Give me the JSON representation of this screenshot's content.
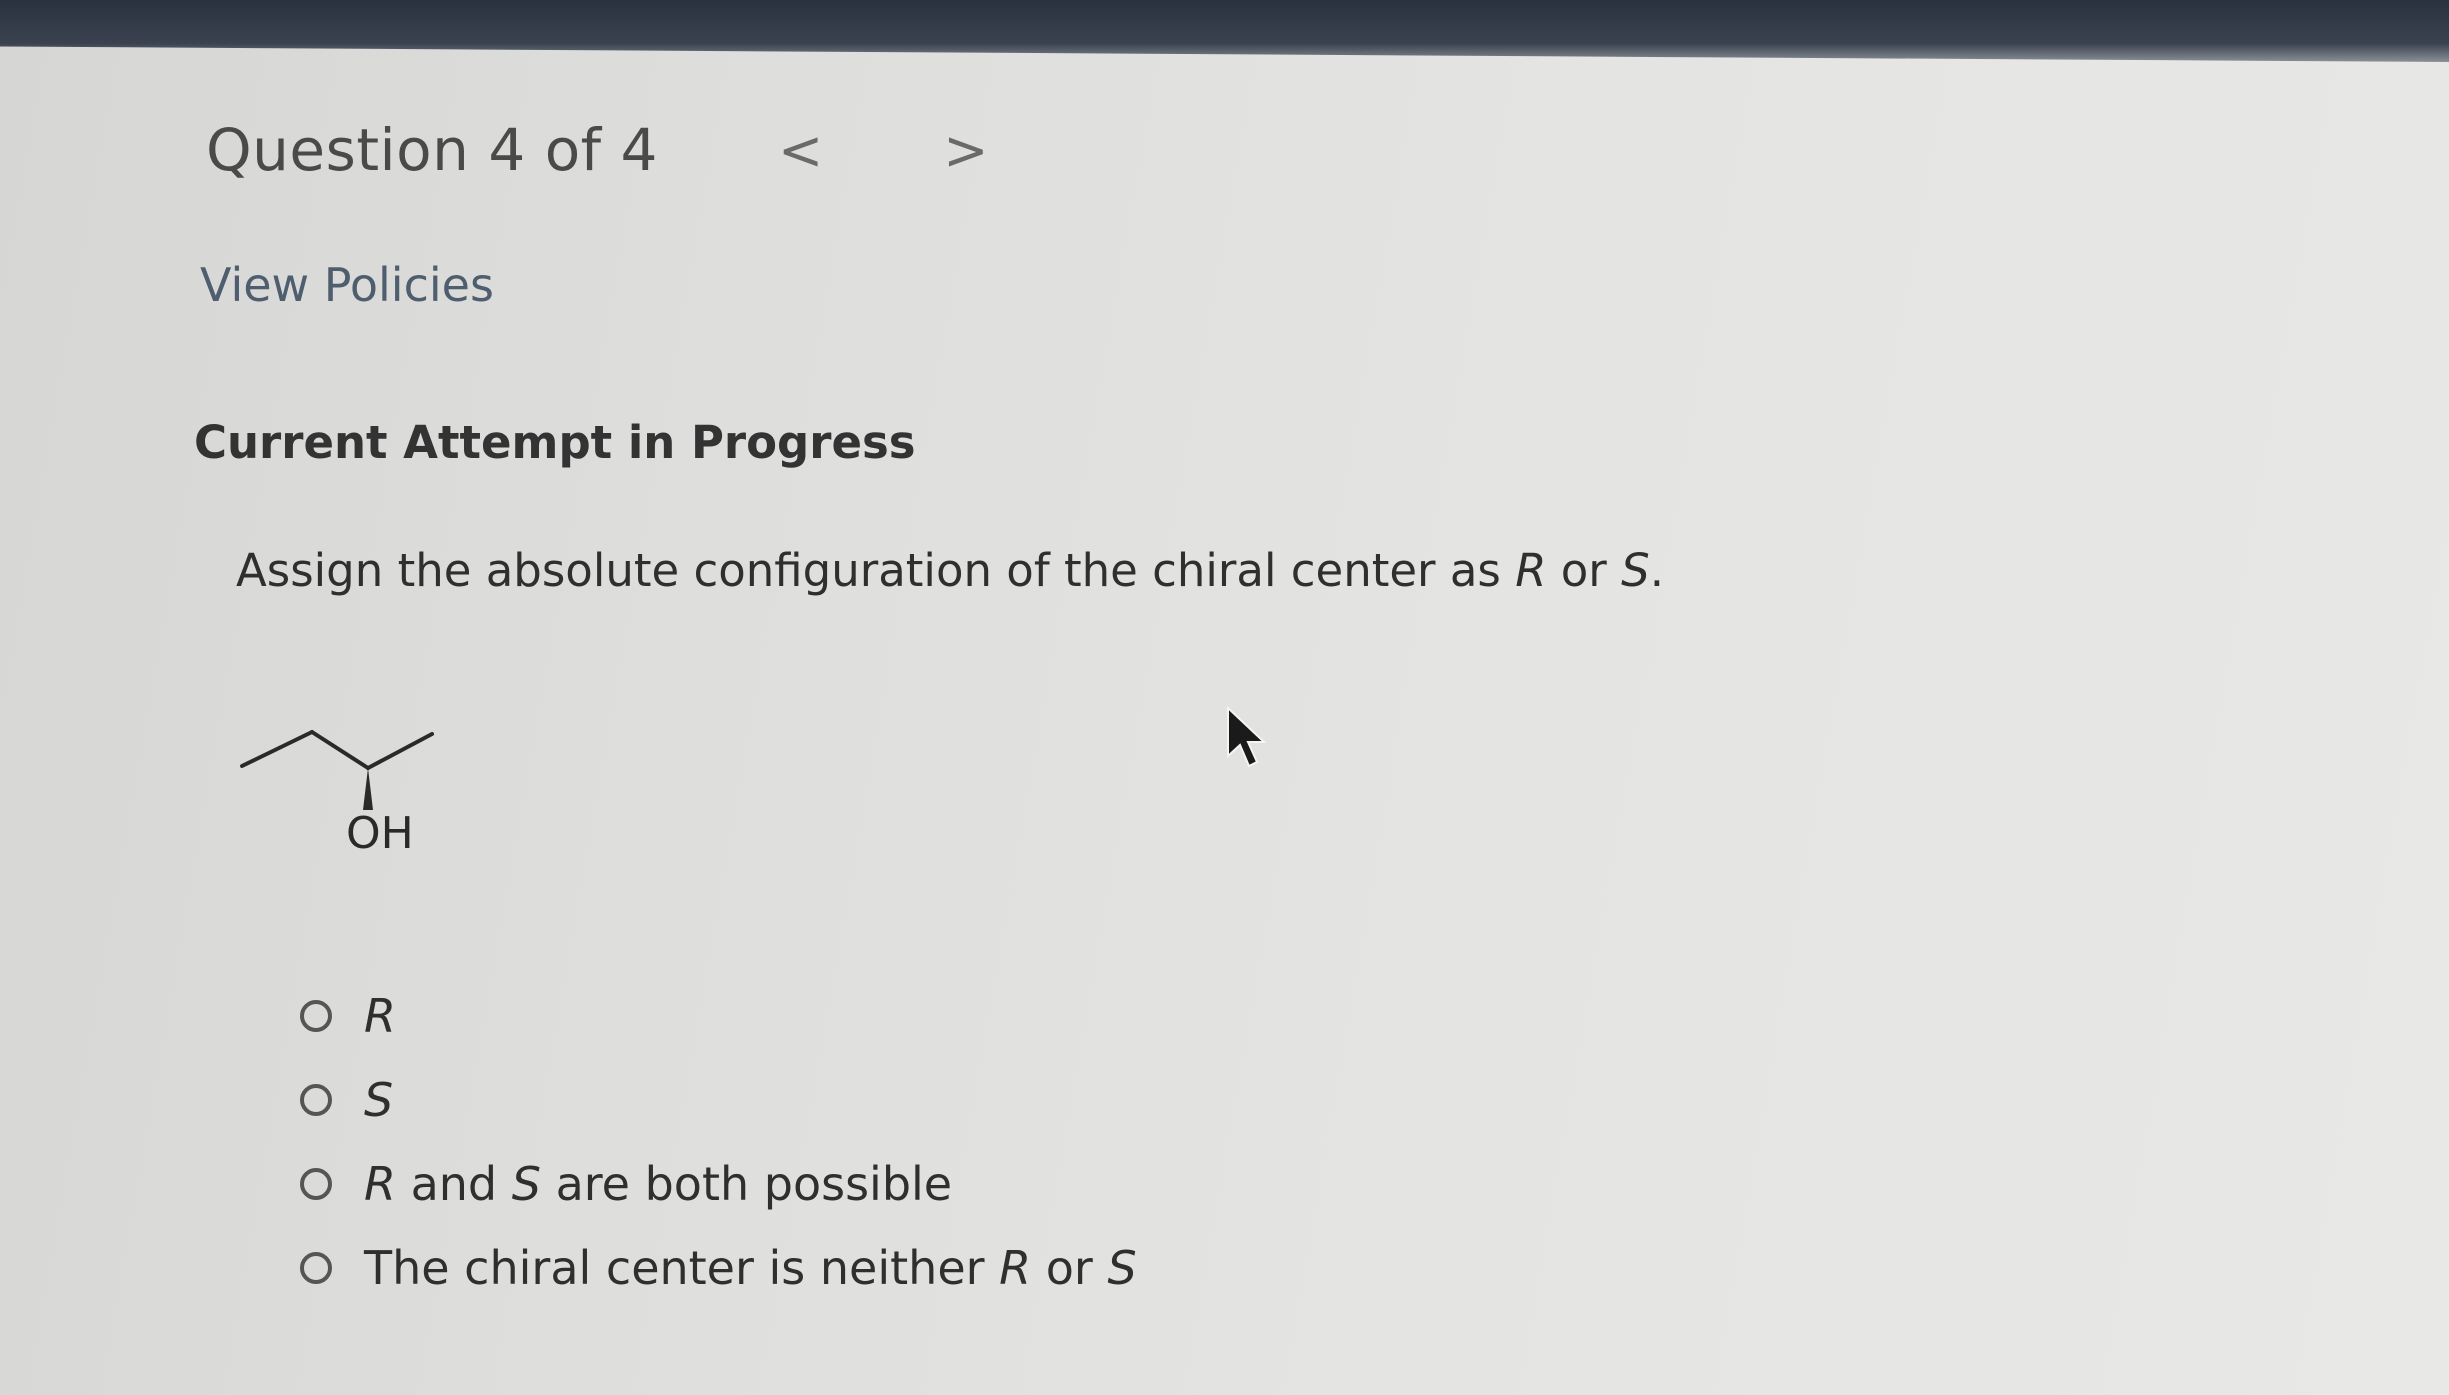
{
  "question": {
    "title": "Question 4 of 4",
    "prev_icon": "chevron-left-icon",
    "next_icon": "chevron-right-icon",
    "prev_glyph": "<",
    "next_glyph": ">"
  },
  "policies": {
    "label": "View Policies"
  },
  "attempt": {
    "heading": "Current Attempt in Progress"
  },
  "prompt": {
    "text_before": "Assign the absolute configuration of the chiral center as ",
    "r": "R",
    "or": " or ",
    "s": "S",
    "end": "."
  },
  "molecule": {
    "substituent_label": "OH"
  },
  "options": [
    {
      "label": "R"
    },
    {
      "label": "S"
    },
    {
      "r": "R",
      "and": " and ",
      "s": "S",
      "rest": " are both possible"
    },
    {
      "text": "The chiral center is neither ",
      "r": "R",
      "or": " or ",
      "s": "S"
    }
  ],
  "cursor": {
    "icon": "mouse-pointer-icon"
  }
}
